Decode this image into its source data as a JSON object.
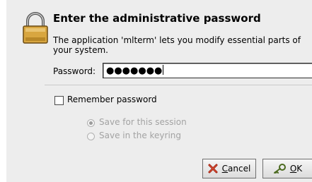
{
  "dialog": {
    "title": "Enter the administrative password",
    "message": "The application 'mlterm' lets you modify essential parts of your system.",
    "password": {
      "label": "Password:",
      "masked_value": "●●●●●●●"
    },
    "remember": {
      "label": "Remember password",
      "checked": false
    },
    "options": [
      {
        "label": "Save for this session",
        "selected": true,
        "enabled": false
      },
      {
        "label": "Save in the keyring",
        "selected": false,
        "enabled": false
      }
    ],
    "buttons": {
      "cancel": {
        "mnemonic": "C",
        "rest": "ancel"
      },
      "ok": {
        "mnemonic": "O",
        "rest": "K"
      }
    }
  },
  "icons": {
    "lock": "padlock-icon",
    "cancel": "cancel-x-icon",
    "ok": "key-icon"
  }
}
